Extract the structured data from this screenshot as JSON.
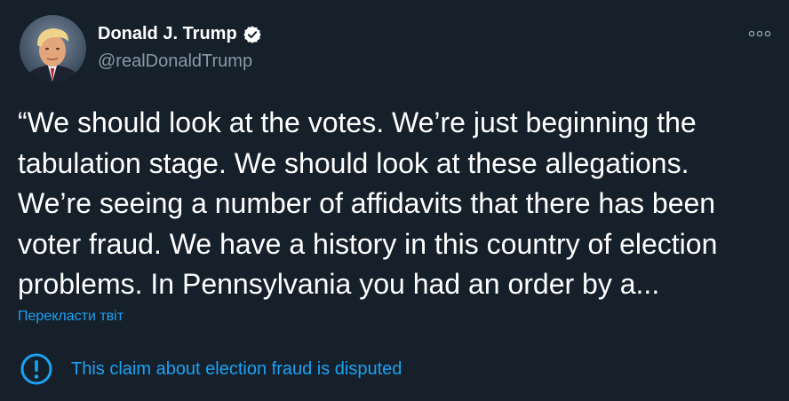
{
  "author": {
    "display_name": "Donald J. Trump",
    "handle": "@realDonaldTrump",
    "verified_icon": "verified-badge-icon",
    "avatar_icon": "profile-photo"
  },
  "tweet": {
    "text": "“We should look at the votes. We’re just beginning the\ntabulation stage. We should look at these allegations.\nWe’re seeing a number of affidavits that there has been\nvoter fraud. We have a history in this country of election\nproblems. In Pennsylvania you had an order by a..."
  },
  "translate_link": "Перекласти твіт",
  "notice": {
    "icon": "exclamation-circle-icon",
    "text": "This claim about election fraud is disputed"
  },
  "more_menu_icon": "more-options-icon",
  "colors": {
    "background": "#15202b",
    "text": "#ffffff",
    "secondary_text": "#8899a6",
    "accent": "#1da1f2"
  }
}
